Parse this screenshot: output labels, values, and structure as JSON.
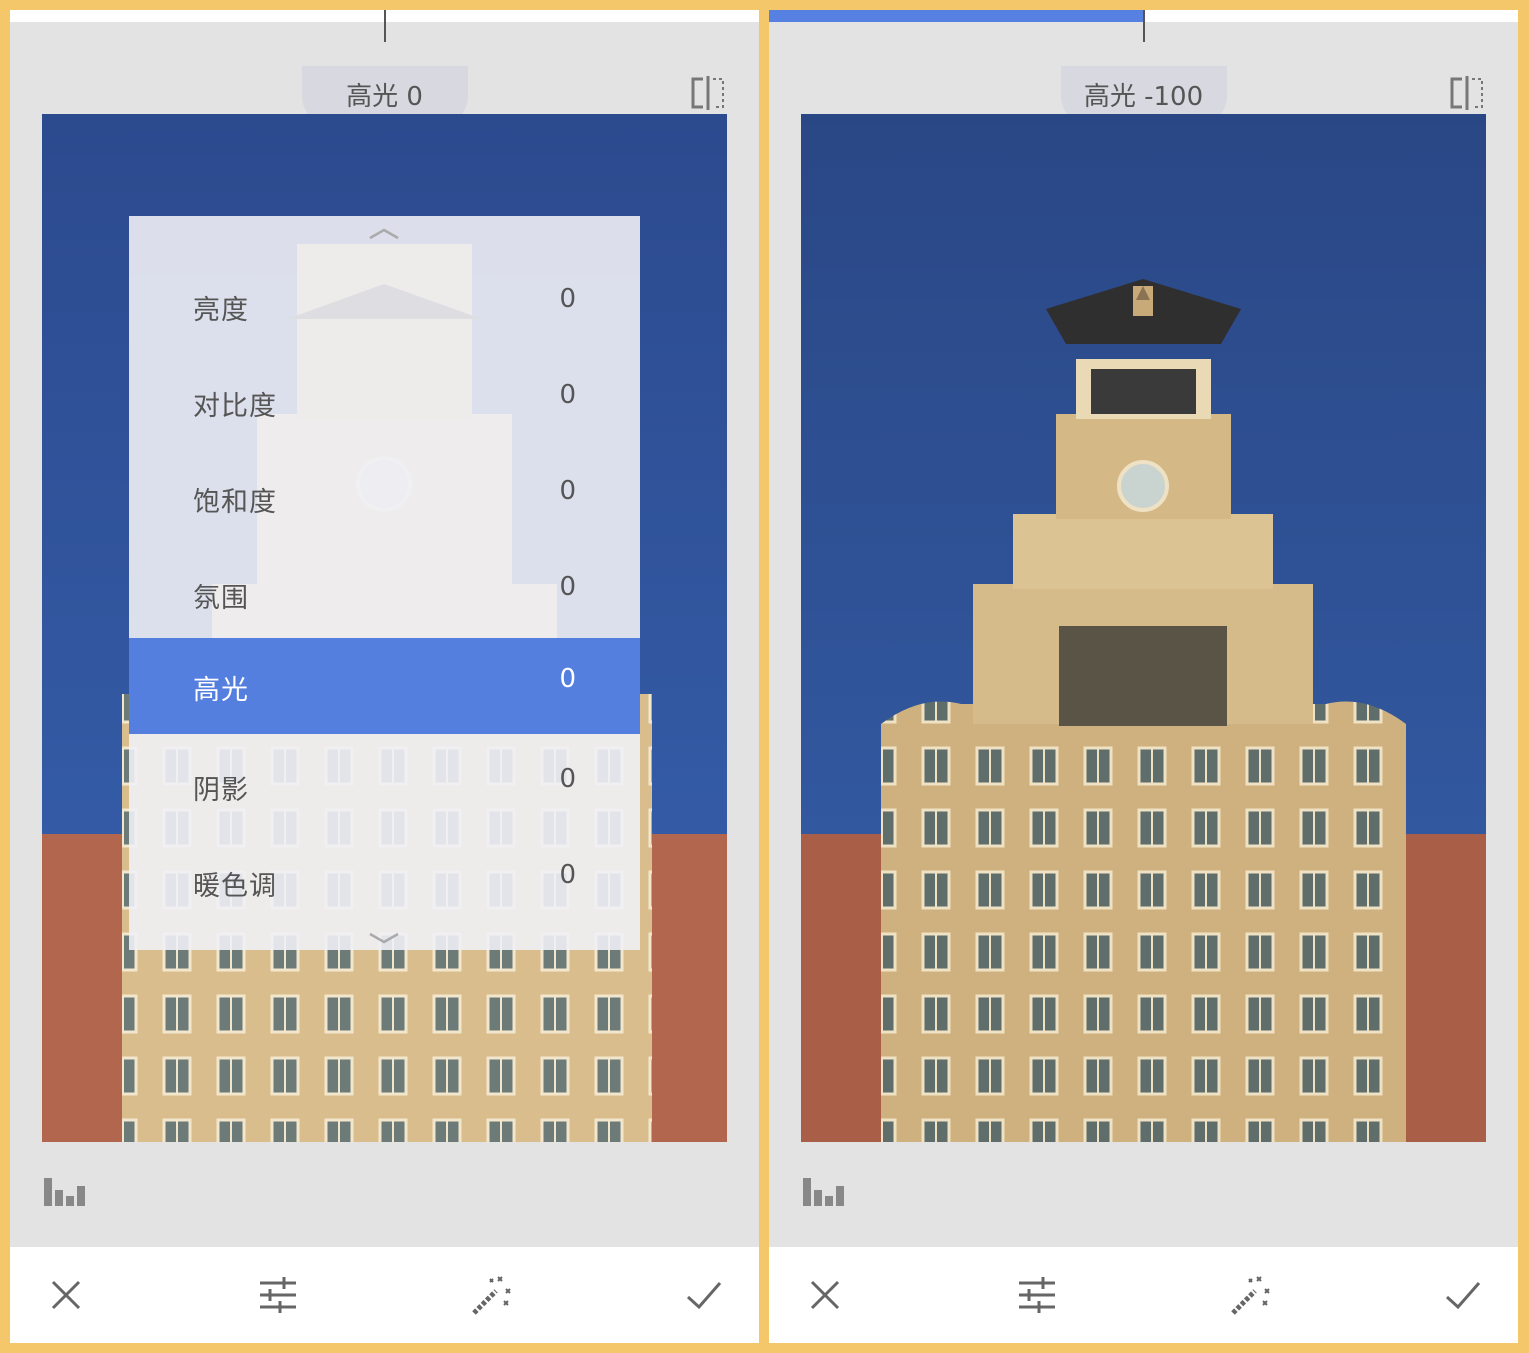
{
  "left": {
    "title": "高光 0",
    "slider_value": 0,
    "menu": {
      "items": [
        {
          "label": "亮度",
          "value": "0"
        },
        {
          "label": "对比度",
          "value": "0"
        },
        {
          "label": "饱和度",
          "value": "0"
        },
        {
          "label": "氛围",
          "value": "0"
        },
        {
          "label": "高光",
          "value": "0",
          "selected": true
        },
        {
          "label": "阴影",
          "value": "0"
        },
        {
          "label": "暖色调",
          "value": "0"
        }
      ]
    }
  },
  "right": {
    "title": "高光 -100",
    "slider_value": -100
  },
  "icons": {
    "compare": "compare-icon",
    "histogram": "histogram-icon",
    "cancel": "close-icon",
    "adjust": "sliders-icon",
    "auto": "magic-wand-icon",
    "apply": "check-icon"
  },
  "colors": {
    "frame": "#f4c76a",
    "accent": "#557fdf",
    "panel_bg": "#e3e3e3",
    "sky": "#2f4f93"
  }
}
